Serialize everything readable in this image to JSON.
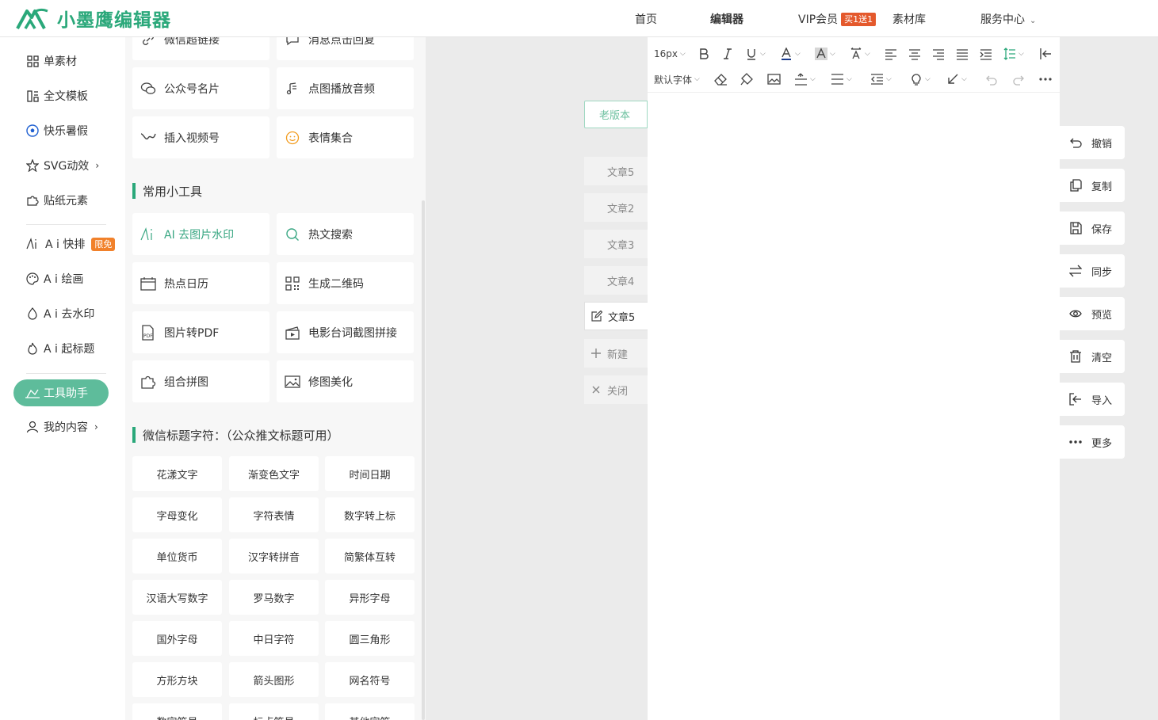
{
  "header": {
    "logo_text": "小墨鹰编辑器",
    "nav": [
      {
        "label": "首页"
      },
      {
        "label": "编辑器"
      },
      {
        "label": "VIP会员",
        "badge": "买1送1"
      },
      {
        "label": "素材库"
      },
      {
        "label": "服务中心"
      }
    ]
  },
  "sidebar": {
    "items": [
      {
        "label": "单素材",
        "icon": "grid-icon"
      },
      {
        "label": "全文模板",
        "icon": "template-icon"
      },
      {
        "label": "快乐暑假",
        "icon": "soccer-ball-icon"
      },
      {
        "label": "SVG动效",
        "icon": "star-icon"
      },
      {
        "label": "贴纸元素",
        "icon": "puzzle-icon"
      },
      {
        "label": "A i 快排",
        "icon": "ai-icon",
        "badge": "限免"
      },
      {
        "label": "A i 绘画",
        "icon": "palette-icon"
      },
      {
        "label": "A i 去水印",
        "icon": "drop-icon"
      },
      {
        "label": "A i 起标题",
        "icon": "flame-icon"
      },
      {
        "label": "工具助手",
        "icon": "tool-icon"
      },
      {
        "label": "我的内容",
        "icon": "user-icon"
      }
    ]
  },
  "panel": {
    "top_cards": [
      "微信超链接",
      "消息点击回复",
      "公众号名片",
      "点图播放音频",
      "插入视频号",
      "表情集合"
    ],
    "tools_title": "常用小工具",
    "tools": [
      "AI 去图片水印",
      "热文搜索",
      "热点日历",
      "生成二维码",
      "图片转PDF",
      "电影台词截图拼接",
      "组合拼图",
      "修图美化"
    ],
    "chars_title": "微信标题字符：（公众推文标题可用）",
    "chars": [
      "花漾文字",
      "渐变色文字",
      "时间日期",
      "字母变化",
      "字符表情",
      "数字转上标",
      "单位货币",
      "汉字转拼音",
      "简繁体互转",
      "汉语大写数字",
      "罗马数字",
      "异形字母",
      "国外字母",
      "中日字符",
      "圆三角形",
      "方形方块",
      "箭头图形",
      "网名符号",
      "数字符号",
      "标点符号",
      "其他字符"
    ]
  },
  "editor": {
    "old_version": "老版本",
    "tabs": [
      "文章5",
      "文章2",
      "文章3",
      "文章4",
      "文章5"
    ],
    "new_label": "新建",
    "close_label": "关闭",
    "font_size": "16px",
    "font_family": "默认字体"
  },
  "actions": [
    {
      "label": "撤销",
      "icon": "undo-icon"
    },
    {
      "label": "复制",
      "icon": "copy-icon"
    },
    {
      "label": "保存",
      "icon": "save-icon"
    },
    {
      "label": "同步",
      "icon": "sync-icon"
    },
    {
      "label": "预览",
      "icon": "eye-icon"
    },
    {
      "label": "清空",
      "icon": "trash-icon"
    },
    {
      "label": "导入",
      "icon": "import-icon"
    },
    {
      "label": "更多",
      "icon": "more-icon"
    }
  ],
  "colors": {
    "brand": "#2aa87a",
    "active_side": "#5ebc9b",
    "badge": "#e4592c"
  }
}
